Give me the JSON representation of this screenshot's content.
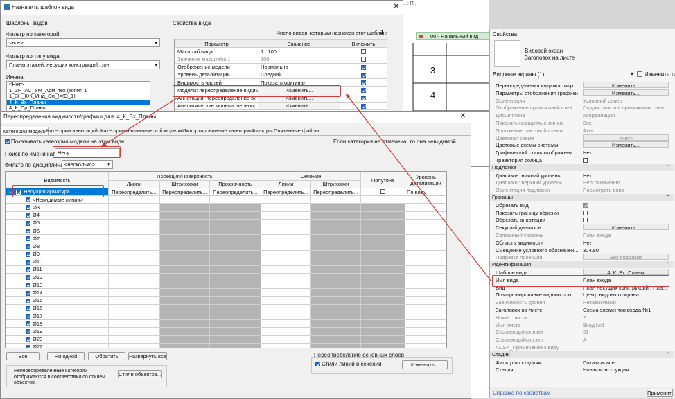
{
  "tmpl": {
    "title": "Назначить шаблон вида",
    "templates_label": "Шаблоны видов",
    "discipline_filter_label": "Фильтр по категорий:",
    "discipline_filter_value": "<все>",
    "type_filter_label": "Фильтр по типу вида:",
    "type_filter_value": "Планы этажей, несущих конструкций, зон",
    "names_label": "Имена:",
    "names": [
      "<Нет>",
      "1_ЗН_АС_УМ_Арм_тех (копия 1",
      "1_ЗН_КЖ_Инд_Оп_(=!О_1)",
      "4_К_Вх_Планы",
      "4_К_Пр_Планы"
    ],
    "props_label": "Свойства вида",
    "count_label": "Число видов, которым назначен этот шаблон:",
    "count_value": "1",
    "col_param": "Параметр",
    "col_value": "Значение",
    "col_include": "Включить",
    "rows": [
      {
        "param": "Масштаб вида",
        "value": "1 : 100",
        "chk": false,
        "dim": false
      },
      {
        "param": "Значение масштаба   1:",
        "value": "100",
        "chk": false,
        "dim": true
      },
      {
        "param": "Отображение модели",
        "value": "Нормально",
        "chk": true,
        "dim": false
      },
      {
        "param": "Уровень детализации",
        "value": "Средний",
        "chk": true,
        "dim": false
      },
      {
        "param": "Видимость частей",
        "value": "Показать оригинал",
        "chk": true,
        "dim": false
      },
      {
        "param": "Модели: переопределение видим",
        "value": "Изменить...",
        "chk": true,
        "dim": false
      },
      {
        "param": "Аннотации: переопределение ви",
        "value": "Изменить...",
        "chk": true,
        "dim": false
      },
      {
        "param": "Аналитические модели: переопр",
        "value": "Изменить...",
        "chk": true,
        "dim": false
      }
    ]
  },
  "vg": {
    "title": "Переопределения видимости/графики для: 4_К_Вх_Планы",
    "tabs": [
      "Категории модели",
      "Категории аннотаций",
      "Категории аналитической модели",
      "Импортированные категории",
      "Фильтры",
      "Связанные файлы"
    ],
    "show_label": "Показывать категории модели на этом виде",
    "note": "Если категория не отмечена, то она невидимой.",
    "search_label": "Поиск по имени катег...",
    "search_value": "Несу",
    "discipline_label": "Фильтр по дисциплинам:",
    "discipline_value": "<несколько>",
    "h_visibility": "Видимость",
    "h_projection": "Проекция/Поверхность",
    "h_section": "Сечение",
    "h_halftone": "Полутона",
    "h_detail": "Уровень детализации",
    "h_lines": "Линии",
    "h_hatch": "Штриховки",
    "h_transp": "Прозрачность",
    "h_lines2": "Линии",
    "h_hatch2": "Штриховки",
    "category": "Несущая арматура",
    "override_btn": "Переопределить...",
    "detail_value": "По виду",
    "sub_items": [
      "<Невидимые линии>",
      "Ø3",
      "Ø4",
      "Ø5",
      "Ø6",
      "Ø7",
      "Ø8",
      "Ø9",
      "Ø10",
      "Ø11",
      "Ø12",
      "Ø13",
      "Ø14",
      "Ø15",
      "Ø16",
      "Ø17",
      "Ø18",
      "Ø19",
      "Ø20",
      "Ø22"
    ],
    "btn_all": "Все",
    "btn_none": "Ни одной",
    "btn_invert": "Обратить",
    "btn_expand": "Развернуть все",
    "hint": "Непереопределенные категории отображаются в соответствии со стилем объектов.",
    "obj_styles_btn": "Стили объектов...",
    "main_override_label": "Переопределение основных слоев",
    "section_styles_label": "Стили линий в сечении",
    "edit_btn": "Изменить..."
  },
  "bg": {
    "view_tab": "00 - Начальный вид",
    "grid_numbers": [
      "3",
      "4"
    ],
    "top_text": "...: П..."
  },
  "props": {
    "title": "Свойства",
    "type_name": "Видовой экран",
    "type_sub": "Заголовок на листе",
    "selector": "Видовые экраны (1)",
    "edit_type": "Изменить тип",
    "apply": "Применить",
    "help": "Справка по свойствам",
    "rows": [
      {
        "k": "row",
        "n": "Переопределения видимости/гр...",
        "v": "Изменить...",
        "btn": true
      },
      {
        "k": "row",
        "n": "Параметры отображения графики",
        "v": "Изменить...",
        "btn": true
      },
      {
        "k": "row",
        "n": "Ориентация",
        "v": "Условный север",
        "dim": true
      },
      {
        "k": "row",
        "n": "Отображение примыканий стен",
        "v": "Подчистить все примыкания стен",
        "dim": true
      },
      {
        "k": "row",
        "n": "Дисциплина",
        "v": "Координация",
        "dim": true
      },
      {
        "k": "row",
        "n": "Показать невидимые линии",
        "v": "Все",
        "dim": true
      },
      {
        "k": "row",
        "n": "Положение цветовой схемы",
        "v": "Фон",
        "dim": true
      },
      {
        "k": "row",
        "n": "Цветовая схема",
        "v": "<нет>",
        "btn": true,
        "dim": true
      },
      {
        "k": "row",
        "n": "Цветовые схемы системы",
        "v": "Изменить...",
        "btn": true
      },
      {
        "k": "row",
        "n": "Графический стиль отображени...",
        "v": "Нет"
      },
      {
        "k": "row",
        "n": "Траектория солнца",
        "chk": "off"
      },
      {
        "k": "sec",
        "n": "Подложка"
      },
      {
        "k": "row",
        "n": "Диапазон: нижний уровень",
        "v": "Нет"
      },
      {
        "k": "row",
        "n": "Диапазон: верхний уровень",
        "v": "Неограниченно",
        "dim": true
      },
      {
        "k": "row",
        "n": "Ориентация подложки",
        "v": "Посмотреть вниз",
        "dim": true
      },
      {
        "k": "sec",
        "n": "Границы"
      },
      {
        "k": "row",
        "n": "Обрезать вид",
        "chk": "on"
      },
      {
        "k": "row",
        "n": "Показать границу обрезки",
        "chk": "off"
      },
      {
        "k": "row",
        "n": "Обрезать аннотации",
        "chk": "off"
      },
      {
        "k": "row",
        "n": "Секущий диапазон",
        "v": "Изменить...",
        "btn": true
      },
      {
        "k": "row",
        "n": "Связанный уровень",
        "v": "План входа",
        "dim": true
      },
      {
        "k": "row",
        "n": "Область видимости",
        "v": "Нет"
      },
      {
        "k": "row",
        "n": "Смещение условного обозначен...",
        "v": "304.80"
      },
      {
        "k": "row",
        "n": "Подрезка проекции",
        "v": "Без подрезки",
        "btn": true,
        "dim": true
      },
      {
        "k": "sec",
        "n": "Идентификация"
      },
      {
        "k": "row",
        "n": "Шаблон вида",
        "v": "4_К_Вх_Планы",
        "btn": true
      },
      {
        "k": "row",
        "n": "Имя вида",
        "v": "План входа"
      },
      {
        "k": "row",
        "n": "Вид",
        "v": "План несущих конструкций : Пла..."
      },
      {
        "k": "row",
        "n": "Позиционирование видового эк...",
        "v": "Центр видового экрана"
      },
      {
        "k": "row",
        "n": "Зависимость уровня",
        "v": "Независимый",
        "dim": true
      },
      {
        "k": "row",
        "n": "Заголовок на листе",
        "v": "Схема элементов входа №1"
      },
      {
        "k": "row",
        "n": "Номер листа",
        "v": "7",
        "dim": true
      },
      {
        "k": "row",
        "n": "Имя листа",
        "v": "Вход №1",
        "dim": true
      },
      {
        "k": "row",
        "n": "Ссылающийся лист",
        "v": "31",
        "dim": true
      },
      {
        "k": "row",
        "n": "Ссылающийся узел",
        "v": "A",
        "dim": true
      },
      {
        "k": "row",
        "n": "ADSK_Примечание к виду",
        "v": "",
        "dim": true
      },
      {
        "k": "sec",
        "n": "Стадии"
      },
      {
        "k": "row",
        "n": "Фильтр по стадиям",
        "v": "Показать все"
      },
      {
        "k": "row",
        "n": "Стадия",
        "v": "Новая конструкция"
      }
    ]
  },
  "colors": {
    "accent": "#1a63c7",
    "highlight": "#d63a3a",
    "selection": "#0078d7"
  }
}
